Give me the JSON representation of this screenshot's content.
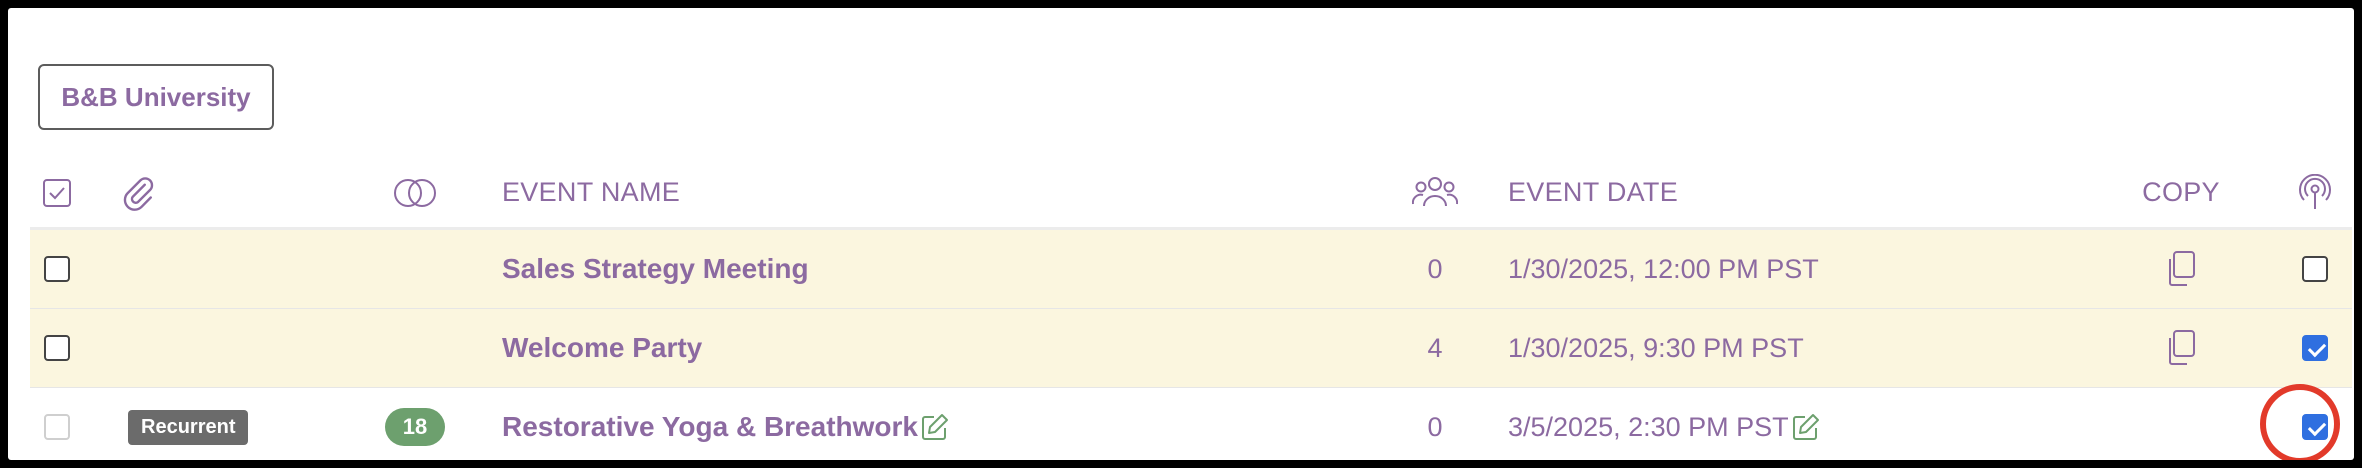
{
  "org_button": {
    "label": "B&B University"
  },
  "table": {
    "headers": {
      "event_name": "EVENT NAME",
      "event_date": "EVENT DATE",
      "copy": "COPY"
    },
    "rows": [
      {
        "name": "Sales Strategy Meeting",
        "attendees": "0",
        "date": "1/30/2025, 12:00 PM PST",
        "select_checked": false,
        "live_checked": false
      },
      {
        "name": "Welcome Party",
        "attendees": "4",
        "date": "1/30/2025, 9:30 PM PST",
        "select_checked": false,
        "live_checked": true
      },
      {
        "name": "Restorative Yoga & Breathwork",
        "attendees": "0",
        "date": "3/5/2025, 2:30 PM PST",
        "badge": "Recurrent",
        "count": "18",
        "select_disabled": true,
        "live_checked": true
      }
    ]
  },
  "colors": {
    "accent": "#8c6aa1",
    "highlight_row": "#fbf6df",
    "checkbox_checked": "#2f6fe0",
    "pill": "#6da06e",
    "ring": "#e23a2a"
  },
  "icons": {
    "select_all": "checkbox-check-icon",
    "attachment": "paperclip-icon",
    "groups": "overlapping-circles-icon",
    "attendees": "people-icon",
    "copy": "copy-icon",
    "live": "broadcast-icon",
    "edit": "pencil-edit-icon"
  }
}
